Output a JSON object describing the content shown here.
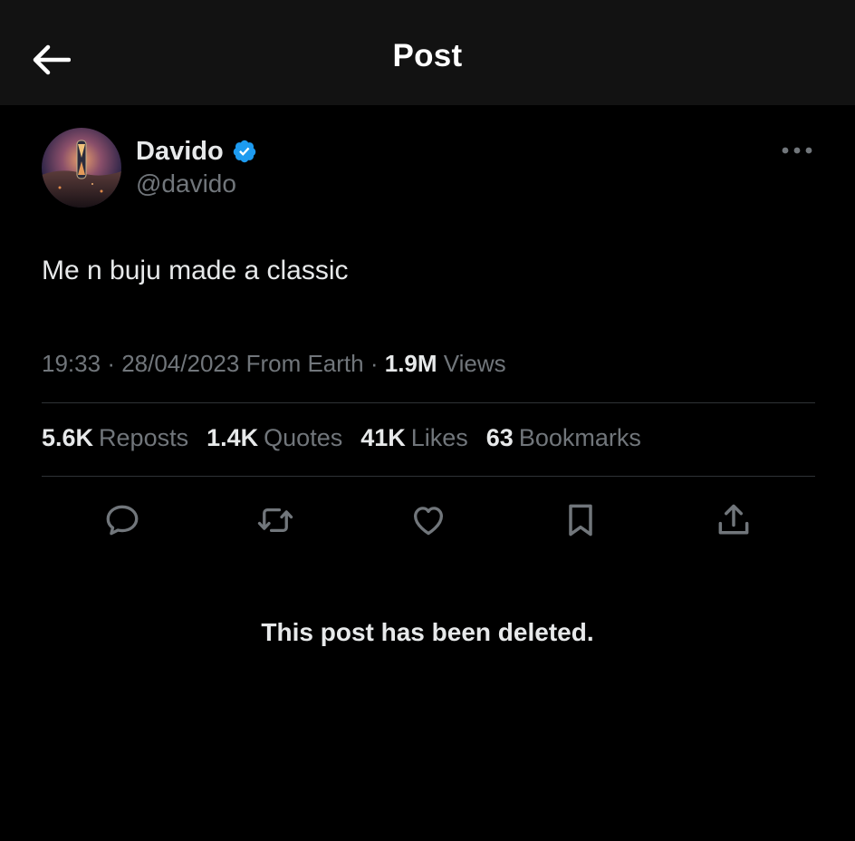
{
  "header": {
    "title": "Post",
    "back_icon": "arrow-left-icon"
  },
  "author": {
    "display_name": "Davido",
    "handle": "@davido",
    "verified": true,
    "verified_color": "#1d9bf0"
  },
  "post": {
    "text": "Me n buju made a classic",
    "time": "19:33",
    "date": "28/04/2023",
    "location": "From Earth",
    "views_count": "1.9M",
    "views_label": "Views"
  },
  "stats": [
    {
      "count": "5.6K",
      "label": "Reposts"
    },
    {
      "count": "1.4K",
      "label": "Quotes"
    },
    {
      "count": "41K",
      "label": "Likes"
    },
    {
      "count": "63",
      "label": "Bookmarks"
    }
  ],
  "actions": [
    "reply-icon",
    "repost-icon",
    "like-icon",
    "bookmark-icon",
    "share-icon"
  ],
  "notice": "This post has been deleted.",
  "colors": {
    "background": "#000000",
    "header_bg": "#121212",
    "primary_text": "#e7e9ea",
    "secondary_text": "#71767b",
    "divider": "#2f3336",
    "accent": "#1d9bf0"
  }
}
